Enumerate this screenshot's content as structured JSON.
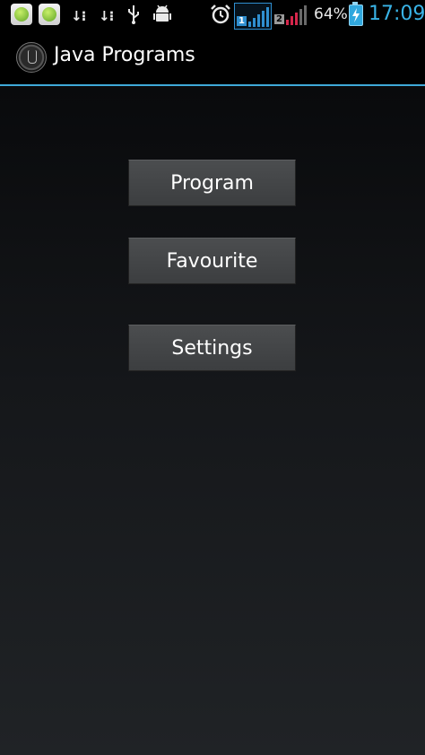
{
  "status_bar": {
    "sim1_label": "1",
    "sim2_label": "2",
    "battery_percent": "64%",
    "time": "17:09",
    "icons": [
      "app-notification-icon",
      "app-notification-icon",
      "download-icon",
      "download-icon",
      "usb-icon",
      "android-debug-icon",
      "alarm-icon",
      "signal-icon",
      "battery-charging-icon"
    ]
  },
  "action_bar": {
    "title": "Java Programs",
    "logo_icon": "java-app-logo-icon"
  },
  "menu": {
    "buttons": [
      {
        "label": "Program"
      },
      {
        "label": "Favourite"
      },
      {
        "label": "Settings"
      }
    ]
  },
  "colors": {
    "accent": "#3fa9d9",
    "clock": "#39b3e6",
    "sim2_signal": "#d6264b"
  }
}
